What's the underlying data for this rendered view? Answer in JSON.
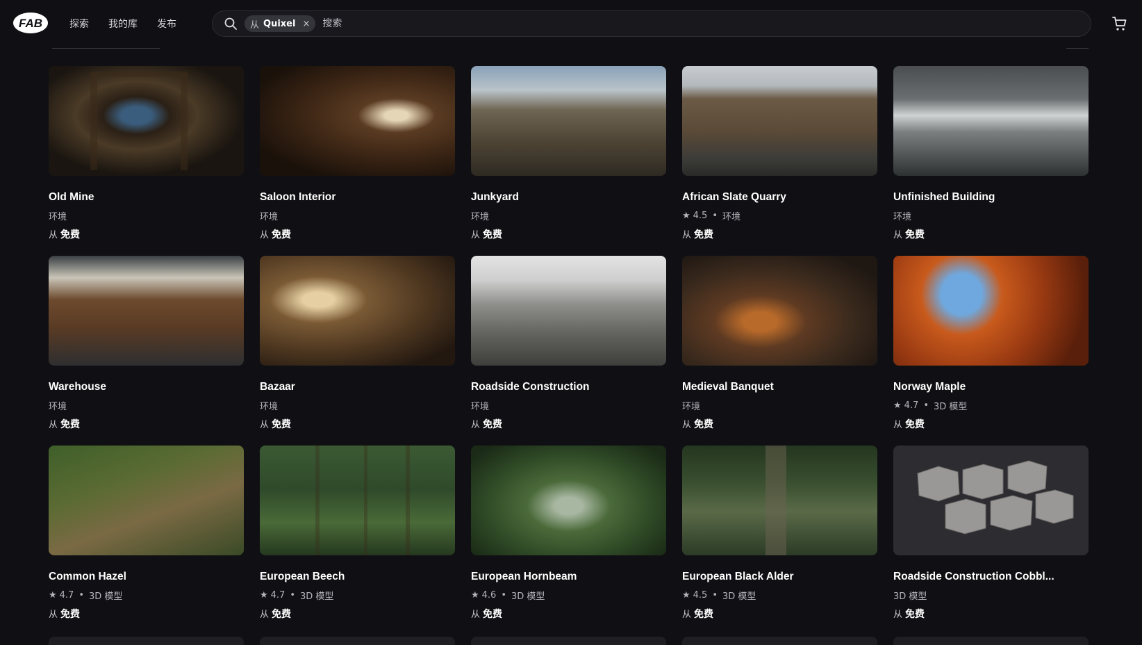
{
  "nav": {
    "logo_text": "FAB",
    "items": [
      "探索",
      "我的库",
      "发布"
    ]
  },
  "search": {
    "chip_from": "从",
    "chip_name": "Quixel",
    "chip_close": "×",
    "placeholder": "搜索"
  },
  "icons": {
    "search": "search-icon",
    "cart": "cart-icon",
    "star": "star-icon"
  },
  "colors": {
    "background": "#101014",
    "text": "#ffffff",
    "muted": "#b4b4bb"
  },
  "cards": [
    {
      "title": "Old Mine",
      "rating": "",
      "category": "环境",
      "price_from": "从",
      "price": "免费"
    },
    {
      "title": "Saloon Interior",
      "rating": "",
      "category": "环境",
      "price_from": "从",
      "price": "免费"
    },
    {
      "title": "Junkyard",
      "rating": "",
      "category": "环境",
      "price_from": "从",
      "price": "免费"
    },
    {
      "title": "African Slate Quarry",
      "rating": "4.5",
      "category": "环境",
      "price_from": "从",
      "price": "免费"
    },
    {
      "title": "Unfinished Building",
      "rating": "",
      "category": "环境",
      "price_from": "从",
      "price": "免费"
    },
    {
      "title": "Warehouse",
      "rating": "",
      "category": "环境",
      "price_from": "从",
      "price": "免费"
    },
    {
      "title": "Bazaar",
      "rating": "",
      "category": "环境",
      "price_from": "从",
      "price": "免费"
    },
    {
      "title": "Roadside Construction",
      "rating": "",
      "category": "环境",
      "price_from": "从",
      "price": "免费"
    },
    {
      "title": "Medieval Banquet",
      "rating": "",
      "category": "环境",
      "price_from": "从",
      "price": "免费"
    },
    {
      "title": "Norway Maple",
      "rating": "4.7",
      "category": "3D 模型",
      "price_from": "从",
      "price": "免费"
    },
    {
      "title": "Common Hazel",
      "rating": "4.7",
      "category": "3D 模型",
      "price_from": "从",
      "price": "免费"
    },
    {
      "title": "European Beech",
      "rating": "4.7",
      "category": "3D 模型",
      "price_from": "从",
      "price": "免费"
    },
    {
      "title": "European Hornbeam",
      "rating": "4.6",
      "category": "3D 模型",
      "price_from": "从",
      "price": "免费"
    },
    {
      "title": "European Black Alder",
      "rating": "4.5",
      "category": "3D 模型",
      "price_from": "从",
      "price": "免费"
    },
    {
      "title": "Roadside Construction Cobbl...",
      "rating": "",
      "category": "3D 模型",
      "price_from": "从",
      "price": "免费"
    }
  ]
}
